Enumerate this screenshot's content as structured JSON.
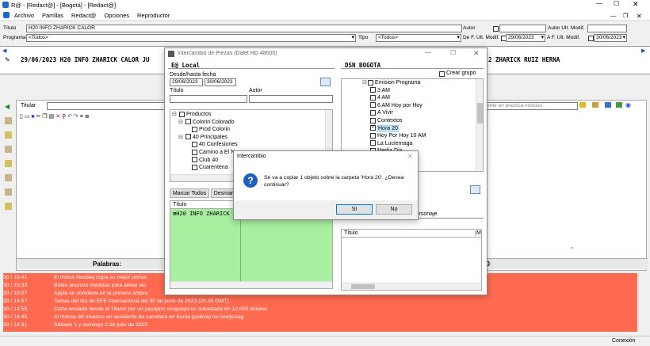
{
  "window": {
    "title": "R@ - [Redact@] - [Bogotá] - [Redact@]"
  },
  "menu": {
    "items": [
      "Archivo",
      "Parrillas",
      "Redact@",
      "Opciones",
      "Reproductor"
    ]
  },
  "form": {
    "titulo_label": "Título",
    "titulo_value": "H20 INFO ZHARICK CALOR",
    "programa_label": "Programa",
    "programa_value": "<Todos>",
    "autor_label": "Autor",
    "autor_ult_label": "Autor Ult. Modif.",
    "tipo_label": "Tipo",
    "tipo_value": "<Todos>",
    "de_fecha_label": "De F. Ult. Modif.",
    "de_fecha_value": "29/06/2023",
    "a_fecha_label": "A F. Ult. Modif.",
    "a_fecha_value": "30/06/2023"
  },
  "ticker": {
    "left": "29/06/2023 H20 INFO ZHARICK CALOR JU",
    "right": "2 ZHARICK RUIZ HERNA"
  },
  "editor": {
    "titular_label": "Titular",
    "search_hint": "ente en practica noticias",
    "palabras_label": "Palabras:",
    "palabras_right": "00"
  },
  "dialog": {
    "title": "Intercambio de Piezas (Dalet HD 48000)",
    "left_header": "E@ Local",
    "desde_label": "Desde/hasta fecha",
    "desde_value": "29/06/2023",
    "hasta_value": "30/06/2023",
    "titulo_label": "Título",
    "autor_label": "Autor",
    "left_tree": [
      {
        "label": "Productos",
        "indent": 0,
        "expander": "⊟"
      },
      {
        "label": "Colorin Colorado",
        "indent": 1,
        "expander": "⊟"
      },
      {
        "label": "Prod Colorin",
        "indent": 2,
        "expander": ""
      },
      {
        "label": "40 Principales",
        "indent": 1,
        "expander": "⊟"
      },
      {
        "label": "40 Confesiones",
        "indent": 2,
        "expander": ""
      },
      {
        "label": "Camino a El Nor",
        "indent": 2,
        "expander": ""
      },
      {
        "label": "Club 40",
        "indent": 2,
        "expander": ""
      },
      {
        "label": "Cuarentena",
        "indent": 2,
        "expander": ""
      }
    ],
    "marcar_todos": "Marcar Todos",
    "desmarcar": "Desmar",
    "list_col_titulo": "Título",
    "list_item": "H20 INFO ZHARICK",
    "right_header": "DSN_BOGOTA_",
    "crear_grupo": "Crear grupo",
    "right_tree": [
      {
        "label": "Emision Programa",
        "indent": 0,
        "checked": false,
        "expander": "⊟"
      },
      {
        "label": "3 AM",
        "indent": 1,
        "checked": false
      },
      {
        "label": "4 AM",
        "indent": 1,
        "checked": false
      },
      {
        "label": "6 AM Hoy por Hoy",
        "indent": 1,
        "checked": false
      },
      {
        "label": "A Vivir",
        "indent": 1,
        "checked": false
      },
      {
        "label": "Contextos",
        "indent": 1,
        "checked": false
      },
      {
        "label": "Hora 20",
        "indent": 1,
        "checked": true,
        "selected": true
      },
      {
        "label": "Hoy Por Hoy 10 AM",
        "indent": 1,
        "checked": false
      },
      {
        "label": "La Luciernaga",
        "indent": 1,
        "checked": false
      },
      {
        "label": "Media Dia",
        "indent": 1,
        "checked": false
      }
    ],
    "personaje_label": "Personaje",
    "right_list_col": "Título",
    "right_list_col2": "M"
  },
  "confirm": {
    "title": "Intercambio",
    "message": "Se va a copiar 1 objeto sobre la carpeta 'Hora 20'. ¿Desea continuar?",
    "yes": "Sí",
    "no": "No"
  },
  "news": [
    {
      "time": "30 / 15:41",
      "text": "El índice Nasdaq logra su mejor primer"
    },
    {
      "time": "30 / 15:33",
      "text": "Biden anuncia medidas para aliviar las"
    },
    {
      "time": "30 / 15:07",
      "text": "Apple se convierte en la primera empre"
    },
    {
      "time": "30 / 14:57",
      "text": "Temas del día de EFE Internacional del 30 de junio de 2023 (20.00 GMT)"
    },
    {
      "time": "30 / 14:55",
      "text": "Carta enviada desde el Titanic por un pasajero uruguayo es subastada en 12.000 dólares"
    },
    {
      "time": "30 / 14:45",
      "text": "Al menos 48 muertos en accidente de carretera en Kenia (policía) ho-txw/js/sag"
    },
    {
      "time": "30 / 14:31",
      "text": "Sábado 1 y domingo 2 de julio de 2023"
    }
  ],
  "status": {
    "conexion": "Conexión"
  },
  "colors": {
    "news_bg": "#ff6a50",
    "list_bg": "#a8f0a0",
    "dialog_accent": "#0078d7"
  }
}
